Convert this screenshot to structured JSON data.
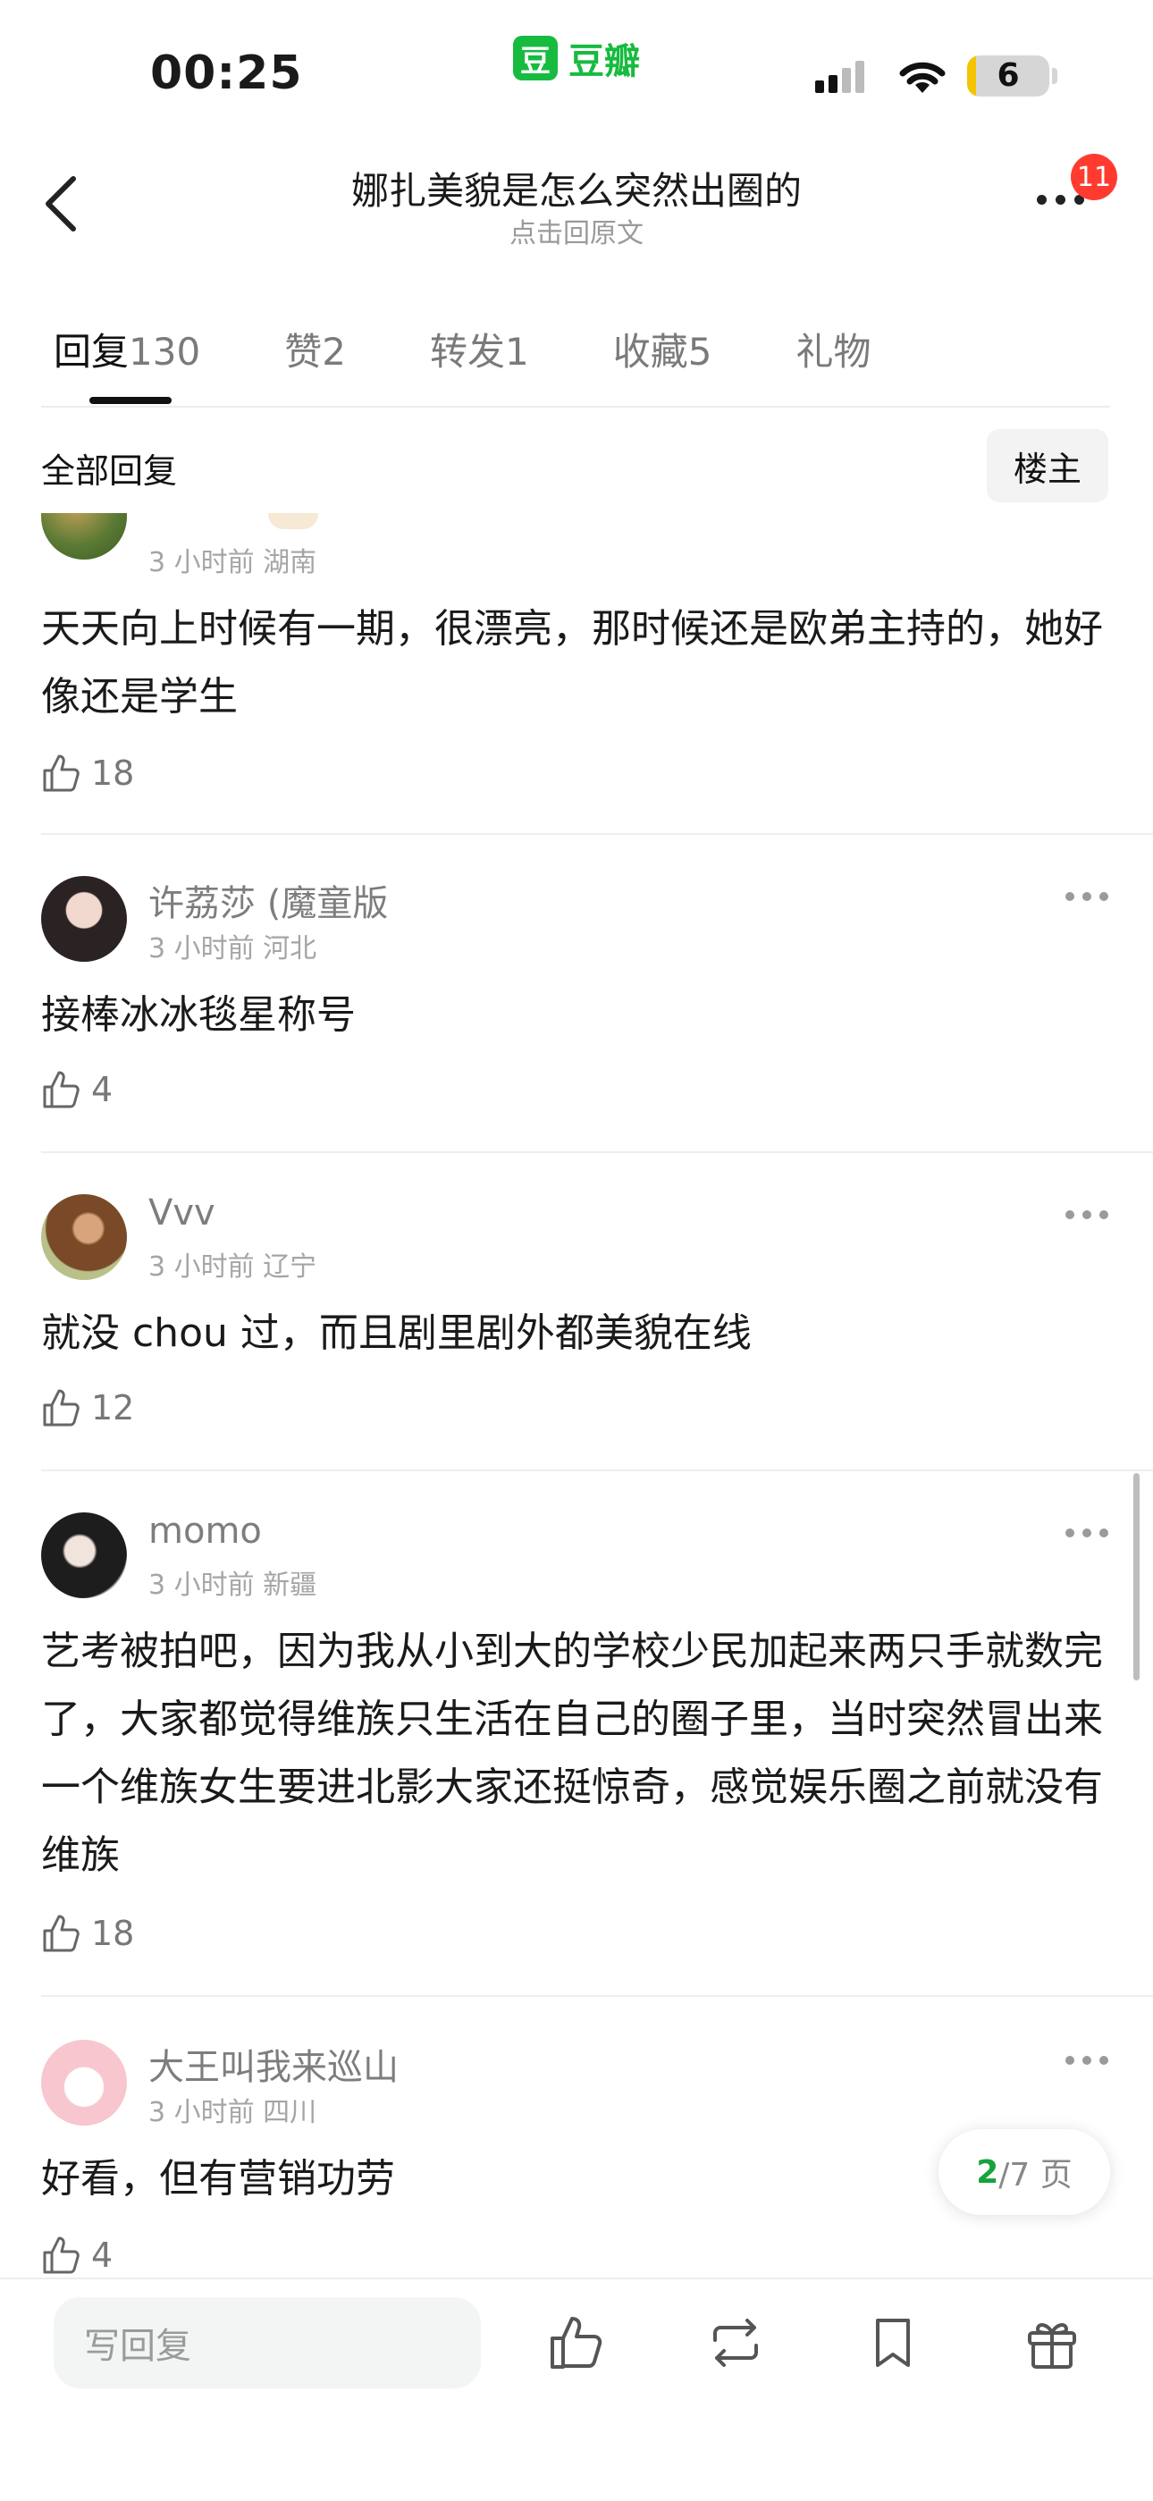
{
  "status_bar": {
    "time": "00:25",
    "app_name": "豆瓣",
    "app_logo_char": "豆",
    "battery": "6",
    "brand_color": "#17bb3f"
  },
  "nav": {
    "title": "娜扎美貌是怎么突然出圈的",
    "subtitle": "点击回原文",
    "badge": "11",
    "back_icon": "chevron-left-icon",
    "more_icon": "more-icon"
  },
  "tabs": [
    {
      "label": "回复",
      "count": "130"
    },
    {
      "label": "赞",
      "count": "2"
    },
    {
      "label": "转发",
      "count": "1"
    },
    {
      "label": "收藏",
      "count": "5"
    },
    {
      "label": "礼物",
      "count": ""
    }
  ],
  "filter": {
    "all_label": "全部回复",
    "op_label": "楼主"
  },
  "comments": [
    {
      "user": "",
      "time": "3 小时前",
      "location": "湖南",
      "text": "天天向上时候有一期，很漂亮，那时候还是欧弟主持的，她好像还是学生",
      "likes": "18"
    },
    {
      "user": "许荔莎 (魔童版",
      "time": "3 小时前",
      "location": "河北",
      "text": "接棒冰冰毯星称号",
      "likes": "4"
    },
    {
      "user": "Vvv",
      "time": "3 小时前",
      "location": "辽宁",
      "text": "就没 chou 过，而且剧里剧外都美貌在线",
      "likes": "12"
    },
    {
      "user": "momo",
      "time": "3 小时前",
      "location": "新疆",
      "text": "艺考被拍吧，因为我从小到大的学校少民加起来两只手就数完了，大家都觉得维族只生活在自己的圈子里，当时突然冒出来一个维族女生要进北影大家还挺惊奇，感觉娱乐圈之前就没有维族",
      "likes": "18"
    },
    {
      "user": "大王叫我来巡山",
      "time": "3 小时前",
      "location": "四川",
      "text": "好看，但有营销功劳",
      "likes": "4"
    }
  ],
  "pager": {
    "current": "2",
    "total": "/7 页"
  },
  "bottom": {
    "reply_placeholder": "写回复",
    "icons": [
      "thumb-up-icon",
      "repost-icon",
      "bookmark-icon",
      "gift-icon"
    ]
  }
}
